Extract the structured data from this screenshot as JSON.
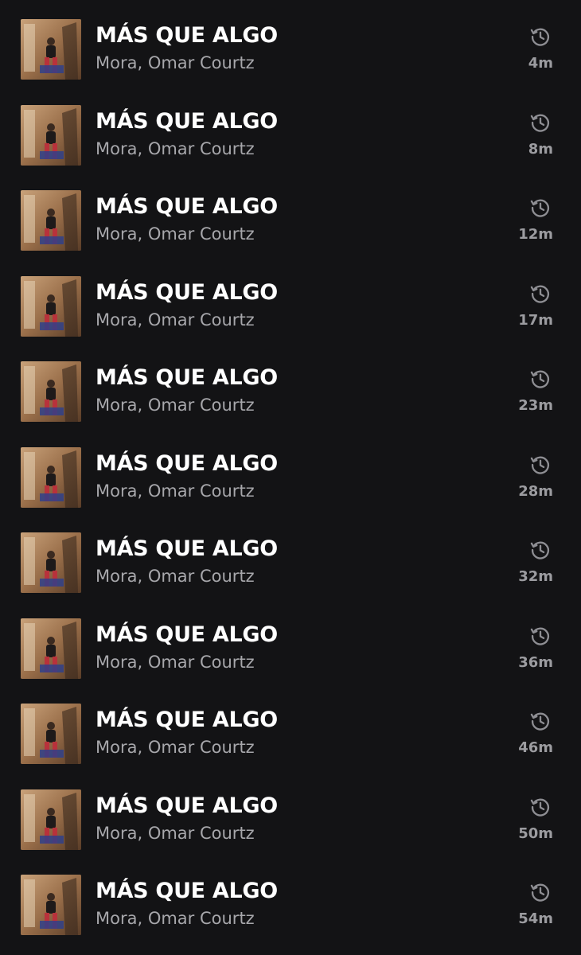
{
  "history": {
    "items": [
      {
        "title": "MÁS QUE ALGO",
        "artist": "Mora, Omar Courtz",
        "played_ago": "4m"
      },
      {
        "title": "MÁS QUE ALGO",
        "artist": "Mora, Omar Courtz",
        "played_ago": "8m"
      },
      {
        "title": "MÁS QUE ALGO",
        "artist": "Mora, Omar Courtz",
        "played_ago": "12m"
      },
      {
        "title": "MÁS QUE ALGO",
        "artist": "Mora, Omar Courtz",
        "played_ago": "17m"
      },
      {
        "title": "MÁS QUE ALGO",
        "artist": "Mora, Omar Courtz",
        "played_ago": "23m"
      },
      {
        "title": "MÁS QUE ALGO",
        "artist": "Mora, Omar Courtz",
        "played_ago": "28m"
      },
      {
        "title": "MÁS QUE ALGO",
        "artist": "Mora, Omar Courtz",
        "played_ago": "32m"
      },
      {
        "title": "MÁS QUE ALGO",
        "artist": "Mora, Omar Courtz",
        "played_ago": "36m"
      },
      {
        "title": "MÁS QUE ALGO",
        "artist": "Mora, Omar Courtz",
        "played_ago": "46m"
      },
      {
        "title": "MÁS QUE ALGO",
        "artist": "Mora, Omar Courtz",
        "played_ago": "50m"
      },
      {
        "title": "MÁS QUE ALGO",
        "artist": "Mora, Omar Courtz",
        "played_ago": "54m"
      }
    ],
    "status_icon": "history-icon",
    "colors": {
      "background": "#131315",
      "title": "#ffffff",
      "subtitle": "#a7a7ab",
      "timestamp": "#9c9ca0"
    }
  }
}
